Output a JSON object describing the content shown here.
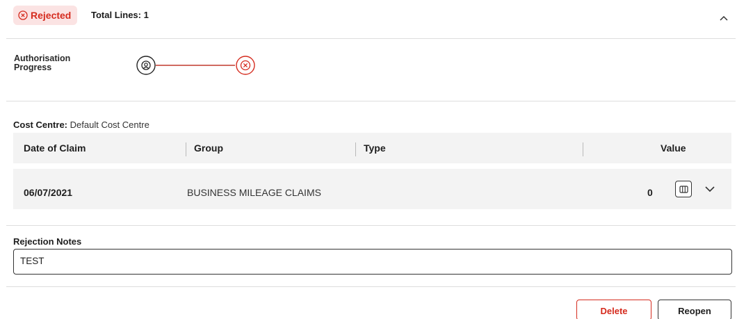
{
  "header": {
    "status": "Rejected",
    "status_color": "#d52b1e",
    "status_bg": "#fbe3e3",
    "total_lines": "Total Lines: 1",
    "collapse_icon": "chevron-up-icon"
  },
  "authorisation": {
    "label": "Authorisation Progress",
    "steps": [
      {
        "icon": "user-icon",
        "state": "submitted"
      },
      {
        "icon": "x-circle-icon",
        "state": "rejected"
      }
    ]
  },
  "cost_centre": {
    "label": "Cost Centre:",
    "value": "Default Cost Centre"
  },
  "table": {
    "columns": [
      "Date of Claim",
      "Group",
      "Type",
      "Value"
    ],
    "rows": [
      {
        "date": "06/07/2021",
        "group": "BUSINESS MILEAGE CLAIMS",
        "type": "",
        "value": "0"
      }
    ]
  },
  "rejection_notes": {
    "label": "Rejection Notes",
    "value": "TEST"
  },
  "actions": {
    "delete": "Delete",
    "reopen": "Reopen"
  }
}
